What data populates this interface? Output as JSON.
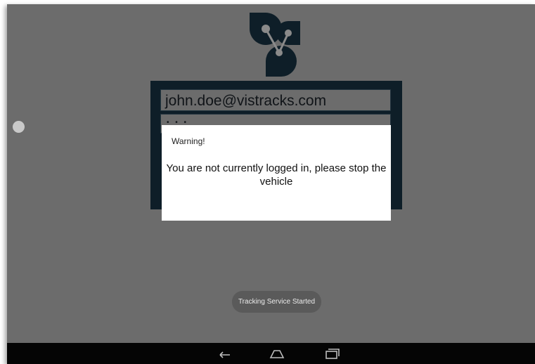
{
  "screen": {
    "background_color": "#6c6c6c",
    "brand_color": "#0e1e28"
  },
  "login": {
    "email_value": "john.doe@vistracks.com",
    "password_masked": "• • •"
  },
  "dialog": {
    "title": "Warning!",
    "message": "You are not currently logged in, please stop the vehicle"
  },
  "toast": {
    "text": "Tracking Service Started"
  },
  "navbar": {
    "buttons": [
      {
        "icon": "back-icon"
      },
      {
        "icon": "home-icon"
      },
      {
        "icon": "recents-icon"
      }
    ]
  }
}
